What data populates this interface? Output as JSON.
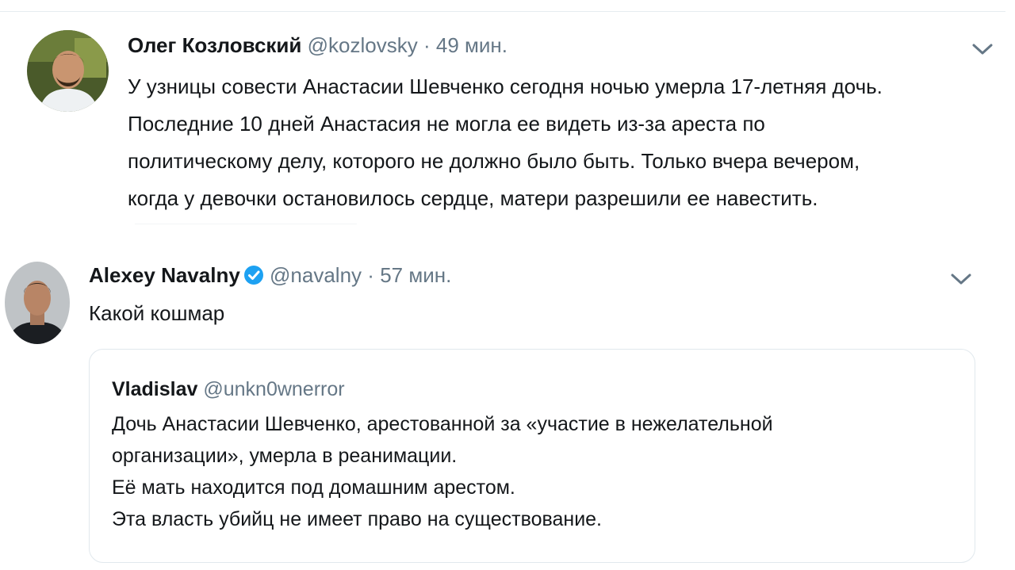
{
  "tweet1": {
    "author_name": "Олег Козловский",
    "author_handle": "@kozlovsky",
    "separator": "·",
    "time": "49 мин.",
    "text_lines": [
      "У узницы совести Анастасии Шевченко сегодня ночью умерла 17-летняя дочь.",
      "Последние 10 дней Анастасия не могла ее видеть из-за ареста по",
      "политическому делу, которого не должно было быть. Только вчера вечером,",
      "когда у девочки остановилось сердце, матери разрешили ее навестить."
    ],
    "menu_icon": "chevron-down-icon"
  },
  "tweet2": {
    "author_name": "Alexey Navalny",
    "verified_icon": "verified-badge-icon",
    "author_handle": "@navalny",
    "separator": "·",
    "time": "57 мин.",
    "text": "Какой кошмар",
    "menu_icon": "chevron-down-icon",
    "quoted": {
      "author_name": "Vladislav",
      "author_handle": "@unkn0wnerror",
      "text_lines": [
        "Дочь Анастасии Шевченко, арестованной за «участие в нежелательной",
        "организации», умерла в реанимации.",
        "Её мать находится под домашним арестом.",
        "Эта власть убийц не имеет право на существование."
      ]
    }
  },
  "colors": {
    "text": "#14171a",
    "secondary": "#657786",
    "verified": "#1da1f2",
    "border": "#e1e8ed"
  }
}
